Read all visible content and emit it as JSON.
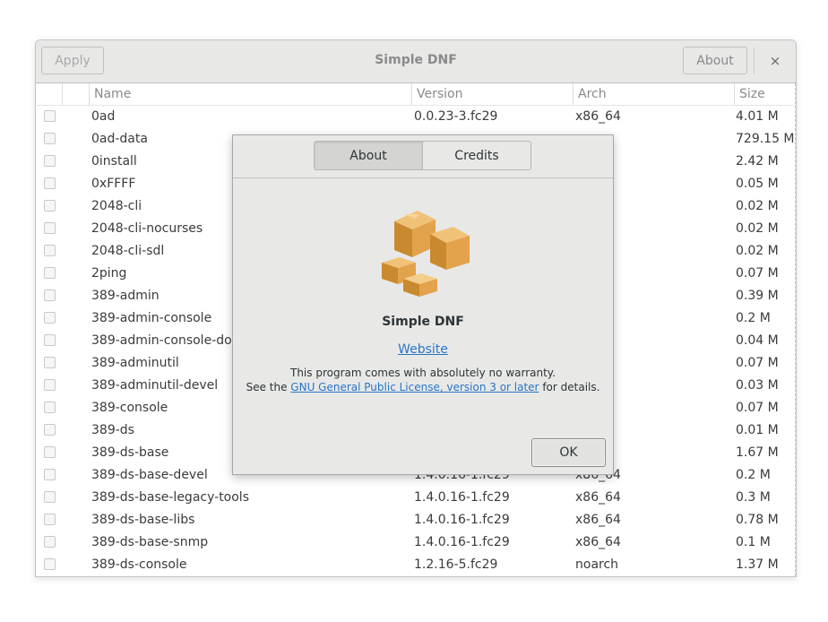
{
  "window": {
    "title": "Simple DNF",
    "apply_label": "Apply",
    "about_label": "About",
    "close_glyph": "×"
  },
  "table": {
    "columns": [
      "Name",
      "Version",
      "Arch",
      "Size"
    ],
    "rows": [
      {
        "name": "0ad",
        "version": "0.0.23-3.fc29",
        "arch": "x86_64",
        "size": "4.01 M"
      },
      {
        "name": "0ad-data",
        "version": "",
        "arch": "",
        "size": "729.15 M"
      },
      {
        "name": "0install",
        "version": "",
        "arch": "",
        "size": "2.42 M"
      },
      {
        "name": "0xFFFF",
        "version": "",
        "arch": "",
        "size": "0.05 M"
      },
      {
        "name": "2048-cli",
        "version": "",
        "arch": "",
        "size": "0.02 M"
      },
      {
        "name": "2048-cli-nocurses",
        "version": "",
        "arch": "",
        "size": "0.02 M"
      },
      {
        "name": "2048-cli-sdl",
        "version": "",
        "arch": "",
        "size": "0.02 M"
      },
      {
        "name": "2ping",
        "version": "",
        "arch": "",
        "size": "0.07 M"
      },
      {
        "name": "389-admin",
        "version": "",
        "arch": "",
        "size": "0.39 M"
      },
      {
        "name": "389-admin-console",
        "version": "",
        "arch": "",
        "size": "0.2 M"
      },
      {
        "name": "389-admin-console-doc",
        "version": "",
        "arch": "",
        "size": "0.04 M"
      },
      {
        "name": "389-adminutil",
        "version": "",
        "arch": "",
        "size": "0.07 M"
      },
      {
        "name": "389-adminutil-devel",
        "version": "",
        "arch": "",
        "size": "0.03 M"
      },
      {
        "name": "389-console",
        "version": "",
        "arch": "",
        "size": "0.07 M"
      },
      {
        "name": "389-ds",
        "version": "",
        "arch": "",
        "size": "0.01 M"
      },
      {
        "name": "389-ds-base",
        "version": "",
        "arch": "",
        "size": "1.67 M"
      },
      {
        "name": "389-ds-base-devel",
        "version": "1.4.0.16-1.fc29",
        "arch": "x86_64",
        "size": "0.2 M"
      },
      {
        "name": "389-ds-base-legacy-tools",
        "version": "1.4.0.16-1.fc29",
        "arch": "x86_64",
        "size": "0.3 M"
      },
      {
        "name": "389-ds-base-libs",
        "version": "1.4.0.16-1.fc29",
        "arch": "x86_64",
        "size": "0.78 M"
      },
      {
        "name": "389-ds-base-snmp",
        "version": "1.4.0.16-1.fc29",
        "arch": "x86_64",
        "size": "0.1 M"
      },
      {
        "name": "389-ds-console",
        "version": "1.2.16-5.fc29",
        "arch": "noarch",
        "size": "1.37 M"
      }
    ]
  },
  "about_dialog": {
    "tabs": [
      "About",
      "Credits"
    ],
    "active_tab": "About",
    "program_name": "Simple DNF",
    "website_label": "Website",
    "warranty_line": "This program comes with absolutely no warranty.",
    "license_prefix": "See the ",
    "license_link": "GNU General Public License, version 3 or later",
    "license_suffix": " for details.",
    "ok_label": "OK",
    "logo_icon": "package-boxes-icon"
  },
  "colors": {
    "link": "#2a76c6",
    "headerbar": "#e8e8e7",
    "box": "#d9a24a"
  }
}
